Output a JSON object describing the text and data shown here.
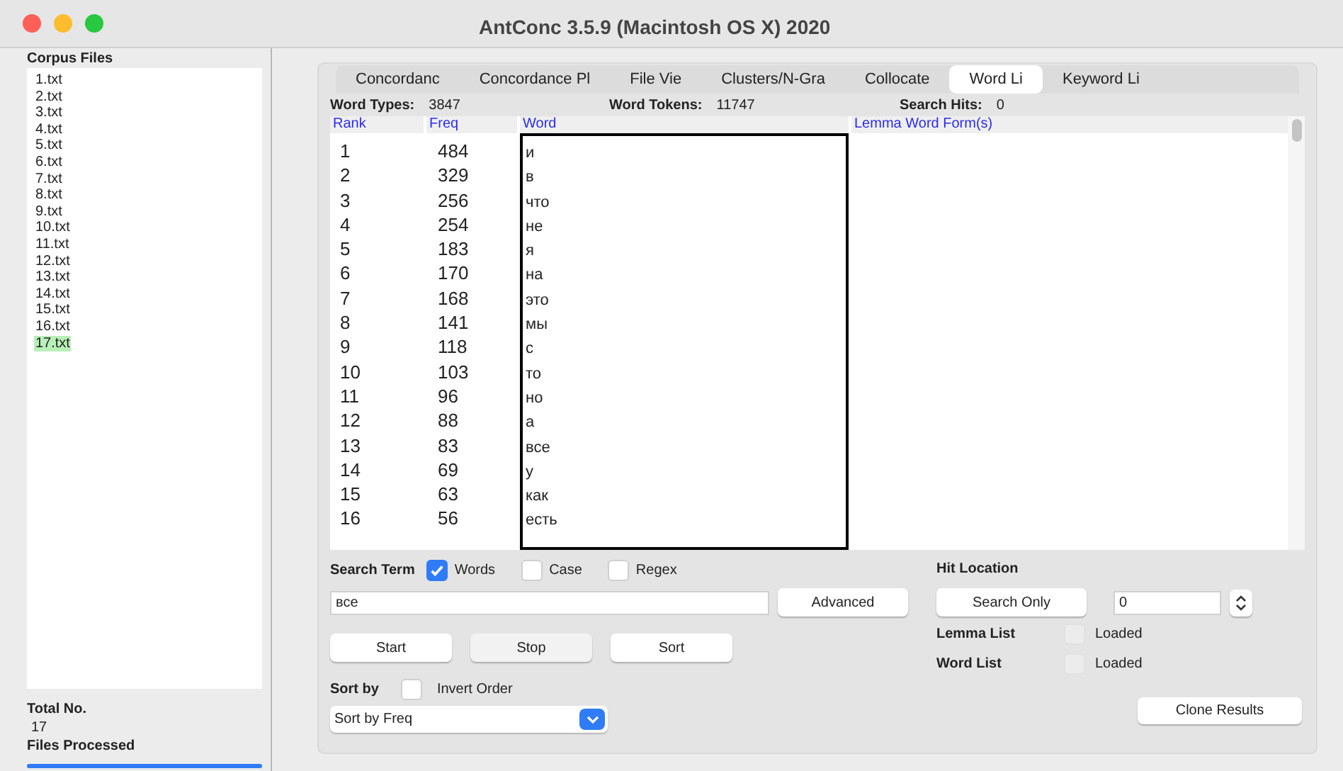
{
  "window": {
    "title": "AntConc 3.5.9 (Macintosh OS X) 2020"
  },
  "sidebar": {
    "heading": "Corpus Files",
    "files": [
      {
        "name": "1.txt",
        "selected": false
      },
      {
        "name": "2.txt",
        "selected": false
      },
      {
        "name": "3.txt",
        "selected": false
      },
      {
        "name": "4.txt",
        "selected": false
      },
      {
        "name": "5.txt",
        "selected": false
      },
      {
        "name": "6.txt",
        "selected": false
      },
      {
        "name": "7.txt",
        "selected": false
      },
      {
        "name": "8.txt",
        "selected": false
      },
      {
        "name": "9.txt",
        "selected": false
      },
      {
        "name": "10.txt",
        "selected": false
      },
      {
        "name": "11.txt",
        "selected": false
      },
      {
        "name": "12.txt",
        "selected": false
      },
      {
        "name": "13.txt",
        "selected": false
      },
      {
        "name": "14.txt",
        "selected": false
      },
      {
        "name": "15.txt",
        "selected": false
      },
      {
        "name": "16.txt",
        "selected": false
      },
      {
        "name": "17.txt",
        "selected": true
      }
    ],
    "total_label": "Total No.",
    "total_value": "17",
    "processed_label": "Files Processed",
    "progress": {
      "level": 1
    }
  },
  "tabs": [
    {
      "label": "Concordanc",
      "selected": false
    },
    {
      "label": "Concordance Pl",
      "selected": false
    },
    {
      "label": "File Vie",
      "selected": false
    },
    {
      "label": "Clusters/N-Gra",
      "selected": false
    },
    {
      "label": "Collocate",
      "selected": false
    },
    {
      "label": "Word Li",
      "selected": true
    },
    {
      "label": "Keyword Li",
      "selected": false
    }
  ],
  "stats": [
    {
      "label": "Word Types:",
      "value": "3847"
    },
    {
      "label": "Word Tokens:",
      "value": "11747"
    },
    {
      "label": "Search Hits:",
      "value": "0"
    }
  ],
  "table": {
    "columns": [
      "Rank",
      "Freq",
      "Word",
      "Lemma Word Form(s)"
    ],
    "rows": [
      [
        "1",
        "484",
        "и"
      ],
      [
        "2",
        "329",
        "в"
      ],
      [
        "3",
        "256",
        "что"
      ],
      [
        "4",
        "254",
        "не"
      ],
      [
        "5",
        "183",
        "я"
      ],
      [
        "6",
        "170",
        "на"
      ],
      [
        "7",
        "168",
        "это"
      ],
      [
        "8",
        "141",
        "мы"
      ],
      [
        "9",
        "118",
        "с"
      ],
      [
        "10",
        "103",
        "то"
      ],
      [
        "11",
        "96",
        "но"
      ],
      [
        "12",
        "88",
        "а"
      ],
      [
        "13",
        "83",
        "все"
      ],
      [
        "14",
        "69",
        "у"
      ],
      [
        "15",
        "63",
        "как"
      ],
      [
        "16",
        "56",
        "есть"
      ]
    ]
  },
  "search": {
    "label": "Search Term",
    "options": [
      {
        "label": "Words",
        "checked": true
      },
      {
        "label": "Case",
        "checked": false
      },
      {
        "label": "Regex",
        "checked": false
      }
    ],
    "value": "все",
    "advanced": "Advanced"
  },
  "buttons": [
    "Start",
    "Stop",
    "Sort"
  ],
  "sort": {
    "label": "Sort by",
    "invert": {
      "label": "Invert Order",
      "checked": false
    },
    "value": "Sort by Freq"
  },
  "hit_location": {
    "label": "Hit Location",
    "button": "Search Only",
    "value": "0"
  },
  "lists": [
    {
      "label": "Lemma List",
      "status": "Loaded",
      "checked": false
    },
    {
      "label": "Word List",
      "status": "Loaded",
      "checked": false
    }
  ],
  "clone": "Clone Results"
}
